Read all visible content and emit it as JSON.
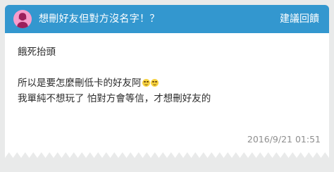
{
  "header": {
    "title": "想刪好友但對方沒名字！？",
    "action_label": "建議回饋",
    "avatar_icon": "female-avatar-icon",
    "background_color": "#3397cf",
    "avatar_color": "#f79ccc"
  },
  "post": {
    "line1": "餓死抬頭",
    "line2": "所以是要怎麼刪低卡的好友阿",
    "line2_emojis": [
      "relieved-face-emoji",
      "relieved-face-emoji"
    ],
    "line3": "我單純不想玩了 怕對方會等信，才想刪好友的"
  },
  "timestamp": "2016/9/21 01:51"
}
